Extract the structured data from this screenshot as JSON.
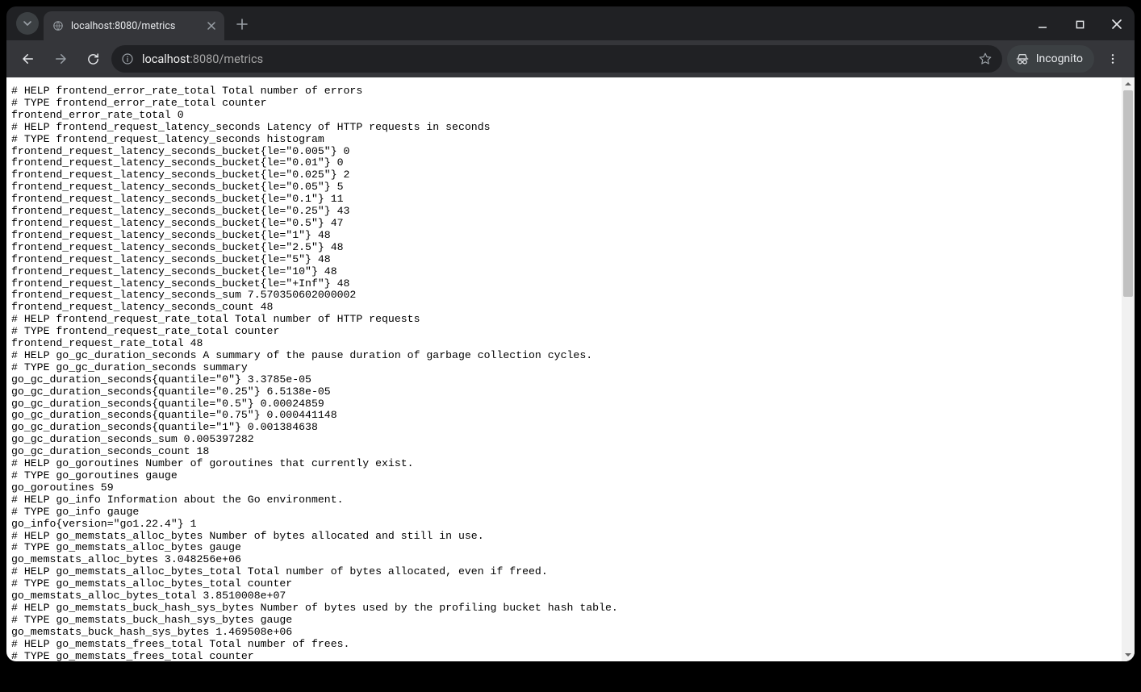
{
  "tab": {
    "title": "localhost:8080/metrics"
  },
  "omnibox": {
    "host": "localhost",
    "path": ":8080/metrics"
  },
  "incognito_label": "Incognito",
  "metrics_lines": [
    "# HELP frontend_error_rate_total Total number of errors",
    "# TYPE frontend_error_rate_total counter",
    "frontend_error_rate_total 0",
    "# HELP frontend_request_latency_seconds Latency of HTTP requests in seconds",
    "# TYPE frontend_request_latency_seconds histogram",
    "frontend_request_latency_seconds_bucket{le=\"0.005\"} 0",
    "frontend_request_latency_seconds_bucket{le=\"0.01\"} 0",
    "frontend_request_latency_seconds_bucket{le=\"0.025\"} 2",
    "frontend_request_latency_seconds_bucket{le=\"0.05\"} 5",
    "frontend_request_latency_seconds_bucket{le=\"0.1\"} 11",
    "frontend_request_latency_seconds_bucket{le=\"0.25\"} 43",
    "frontend_request_latency_seconds_bucket{le=\"0.5\"} 47",
    "frontend_request_latency_seconds_bucket{le=\"1\"} 48",
    "frontend_request_latency_seconds_bucket{le=\"2.5\"} 48",
    "frontend_request_latency_seconds_bucket{le=\"5\"} 48",
    "frontend_request_latency_seconds_bucket{le=\"10\"} 48",
    "frontend_request_latency_seconds_bucket{le=\"+Inf\"} 48",
    "frontend_request_latency_seconds_sum 7.570350602000002",
    "frontend_request_latency_seconds_count 48",
    "# HELP frontend_request_rate_total Total number of HTTP requests",
    "# TYPE frontend_request_rate_total counter",
    "frontend_request_rate_total 48",
    "# HELP go_gc_duration_seconds A summary of the pause duration of garbage collection cycles.",
    "# TYPE go_gc_duration_seconds summary",
    "go_gc_duration_seconds{quantile=\"0\"} 3.3785e-05",
    "go_gc_duration_seconds{quantile=\"0.25\"} 6.5138e-05",
    "go_gc_duration_seconds{quantile=\"0.5\"} 0.00024859",
    "go_gc_duration_seconds{quantile=\"0.75\"} 0.000441148",
    "go_gc_duration_seconds{quantile=\"1\"} 0.001384638",
    "go_gc_duration_seconds_sum 0.005397282",
    "go_gc_duration_seconds_count 18",
    "# HELP go_goroutines Number of goroutines that currently exist.",
    "# TYPE go_goroutines gauge",
    "go_goroutines 59",
    "# HELP go_info Information about the Go environment.",
    "# TYPE go_info gauge",
    "go_info{version=\"go1.22.4\"} 1",
    "# HELP go_memstats_alloc_bytes Number of bytes allocated and still in use.",
    "# TYPE go_memstats_alloc_bytes gauge",
    "go_memstats_alloc_bytes 3.048256e+06",
    "# HELP go_memstats_alloc_bytes_total Total number of bytes allocated, even if freed.",
    "# TYPE go_memstats_alloc_bytes_total counter",
    "go_memstats_alloc_bytes_total 3.8510008e+07",
    "# HELP go_memstats_buck_hash_sys_bytes Number of bytes used by the profiling bucket hash table.",
    "# TYPE go_memstats_buck_hash_sys_bytes gauge",
    "go_memstats_buck_hash_sys_bytes 1.469508e+06",
    "# HELP go_memstats_frees_total Total number of frees.",
    "# TYPE go_memstats_frees_total counter"
  ]
}
